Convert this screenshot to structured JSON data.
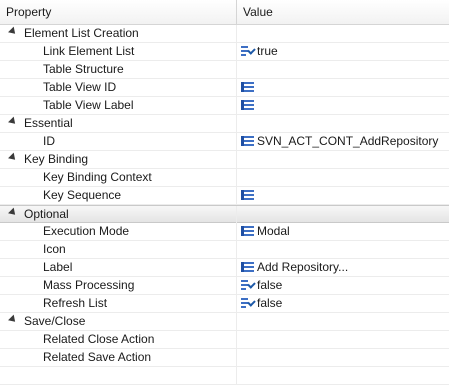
{
  "header": {
    "property": "Property",
    "value": "Value"
  },
  "groups": [
    {
      "label": "Element List Creation",
      "children": [
        {
          "label": "Link Element List",
          "value": "true",
          "icon": "boolean-icon"
        },
        {
          "label": "Table Structure",
          "value": "",
          "icon": ""
        },
        {
          "label": "Table View ID",
          "value": "",
          "icon": "list-icon"
        },
        {
          "label": "Table View Label",
          "value": "",
          "icon": "list-icon"
        }
      ]
    },
    {
      "label": "Essential",
      "children": [
        {
          "label": "ID",
          "value": "SVN_ACT_CONT_AddRepository",
          "icon": "list-icon"
        }
      ]
    },
    {
      "label": "Key Binding",
      "children": [
        {
          "label": "Key Binding Context",
          "value": "",
          "icon": ""
        },
        {
          "label": "Key Sequence",
          "value": "",
          "icon": "list-icon"
        }
      ]
    },
    {
      "label": "Optional",
      "selected": true,
      "children": [
        {
          "label": "Execution Mode",
          "value": "Modal",
          "icon": "list-icon"
        },
        {
          "label": "Icon",
          "value": "",
          "icon": ""
        },
        {
          "label": "Label",
          "value": "Add Repository...",
          "icon": "list-icon"
        },
        {
          "label": "Mass Processing",
          "value": "false",
          "icon": "boolean-icon"
        },
        {
          "label": "Refresh List",
          "value": "false",
          "icon": "boolean-icon"
        }
      ]
    },
    {
      "label": "Save/Close",
      "children": [
        {
          "label": "Related Close Action",
          "value": "",
          "icon": ""
        },
        {
          "label": "Related Save Action",
          "value": "",
          "icon": ""
        }
      ]
    }
  ]
}
